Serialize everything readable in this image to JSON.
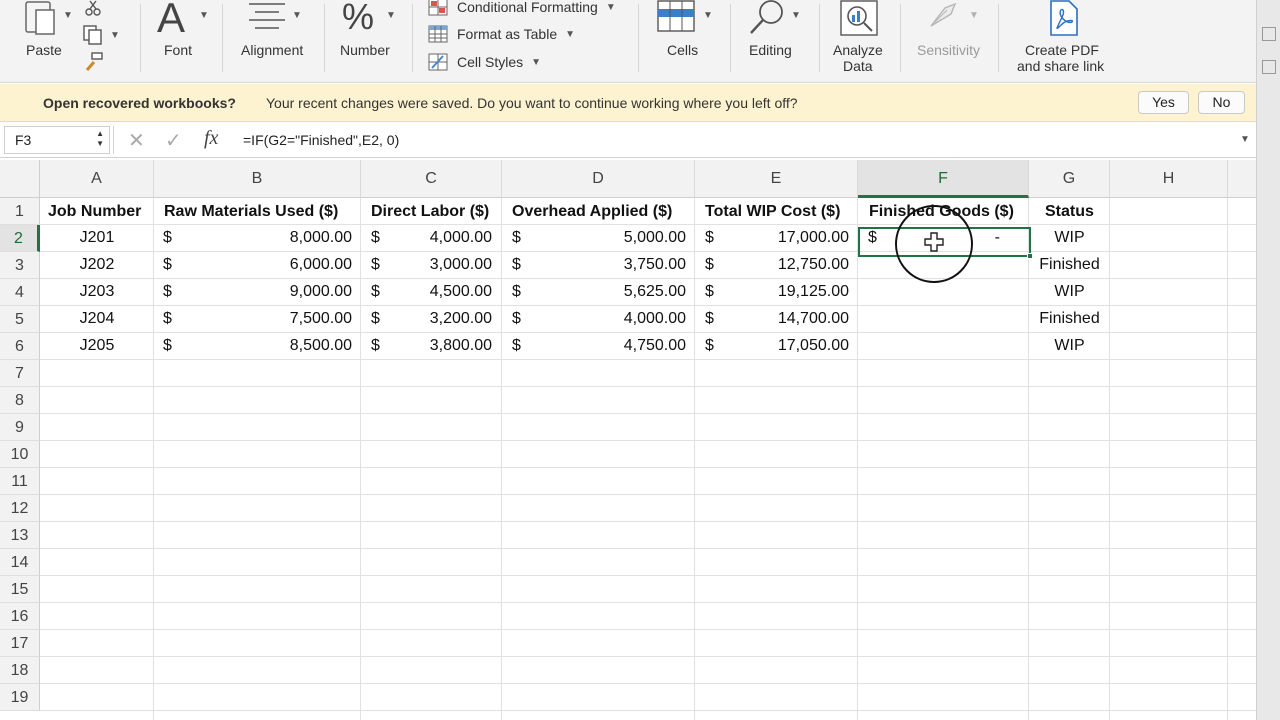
{
  "ribbon": {
    "paste_label": "Paste",
    "font_label": "Font",
    "font_glyph": "A",
    "alignment_label": "Alignment",
    "number_label": "Number",
    "number_glyph": "%",
    "conditional_formatting": "Conditional Formatting",
    "format_as_table": "Format as Table",
    "cell_styles": "Cell Styles",
    "cells_label": "Cells",
    "editing_label": "Editing",
    "analyze_label_1": "Analyze",
    "analyze_label_2": "Data",
    "sensitivity_label": "Sensitivity",
    "create_pdf_label_1": "Create PDF",
    "create_pdf_label_2": "and share link"
  },
  "notification": {
    "title": "Open recovered workbooks?",
    "message": "Your recent changes were saved. Do you want to continue working where you left off?",
    "yes_label": "Yes",
    "no_label": "No"
  },
  "formula_bar": {
    "name_box": "F3",
    "cancel_glyph": "✕",
    "enter_glyph": "✓",
    "fx_glyph": "fx",
    "formula": "=IF(G2=\"Finished\",E2, 0)"
  },
  "columns": [
    "A",
    "B",
    "C",
    "D",
    "E",
    "F",
    "G",
    "H"
  ],
  "active_column": "F",
  "active_row": "2",
  "rows": [
    "1",
    "2",
    "3",
    "4",
    "5",
    "6",
    "7",
    "8",
    "9",
    "10",
    "11",
    "12",
    "13",
    "14",
    "15",
    "16",
    "17",
    "18",
    "19"
  ],
  "headers": {
    "a": "Job Number",
    "b": "Raw Materials Used ($)",
    "c": "Direct Labor ($)",
    "d": "Overhead Applied ($)",
    "e": "Total WIP Cost ($)",
    "f": "Finished Goods ($)",
    "g": "Status"
  },
  "currency_symbol": "$",
  "data_rows": [
    {
      "job": "J201",
      "raw": "8,000.00",
      "labor": "4,000.00",
      "overhead": "5,000.00",
      "total": "17,000.00",
      "finished_symbol": "$",
      "finished": "-",
      "status": "WIP"
    },
    {
      "job": "J202",
      "raw": "6,000.00",
      "labor": "3,000.00",
      "overhead": "3,750.00",
      "total": "12,750.00",
      "finished_symbol": "",
      "finished": "",
      "status": "Finished"
    },
    {
      "job": "J203",
      "raw": "9,000.00",
      "labor": "4,500.00",
      "overhead": "5,625.00",
      "total": "19,125.00",
      "finished_symbol": "",
      "finished": "",
      "status": "WIP"
    },
    {
      "job": "J204",
      "raw": "7,500.00",
      "labor": "3,200.00",
      "overhead": "4,000.00",
      "total": "14,700.00",
      "finished_symbol": "",
      "finished": "",
      "status": "Finished"
    },
    {
      "job": "J205",
      "raw": "8,500.00",
      "labor": "3,800.00",
      "overhead": "4,750.00",
      "total": "17,050.00",
      "finished_symbol": "",
      "finished": "",
      "status": "WIP"
    }
  ],
  "colors": {
    "accent_green": "#217346",
    "notification_bg": "#fdf3d0"
  },
  "icons": [
    "paste-icon",
    "cut-icon",
    "copy-icon",
    "format-painter-icon",
    "font-icon",
    "alignment-icon",
    "number-icon",
    "conditional-formatting-icon",
    "format-as-table-icon",
    "cell-styles-icon",
    "cells-icon",
    "editing-icon",
    "analyze-data-icon",
    "sensitivity-icon",
    "create-pdf-icon",
    "cell-cursor-icon"
  ]
}
